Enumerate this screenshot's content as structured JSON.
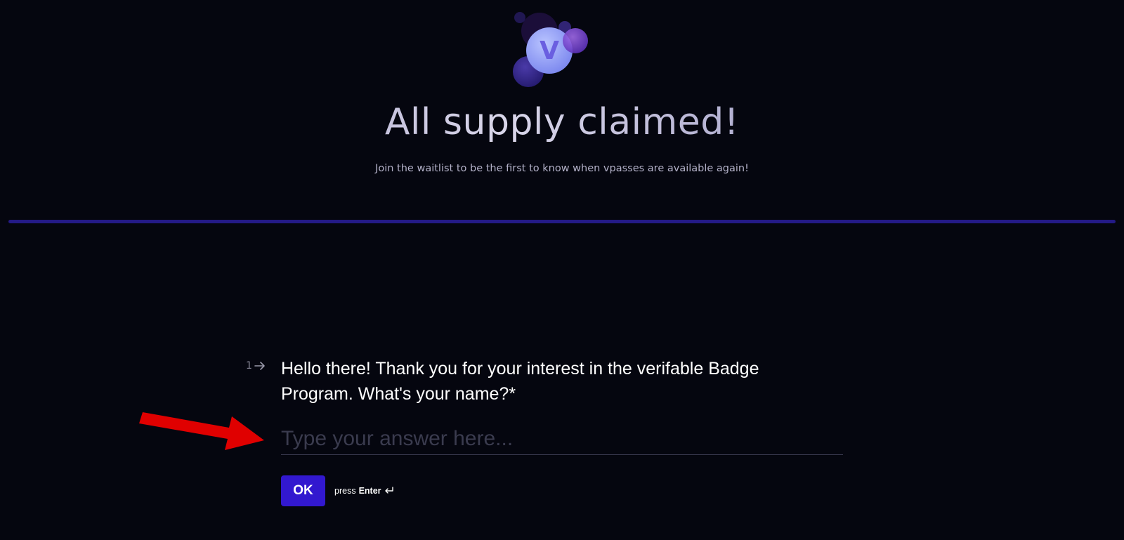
{
  "brand": {
    "logo_letter": "V"
  },
  "hero": {
    "title": "All supply claimed!",
    "subtitle": "Join the waitlist to be the first to know when vpasses are available again!"
  },
  "question": {
    "number": "1",
    "text": "Hello there! Thank you for your interest in the verifable Badge Program. What's your name?*"
  },
  "answer": {
    "placeholder": "Type your answer here...",
    "value": ""
  },
  "actions": {
    "ok_label": "OK",
    "hint_prefix": "press",
    "hint_key": "Enter"
  },
  "colors": {
    "background": "#05060f",
    "divider": "#241a86",
    "ok_button": "#3218cf",
    "annotation_arrow": "#e00000"
  }
}
